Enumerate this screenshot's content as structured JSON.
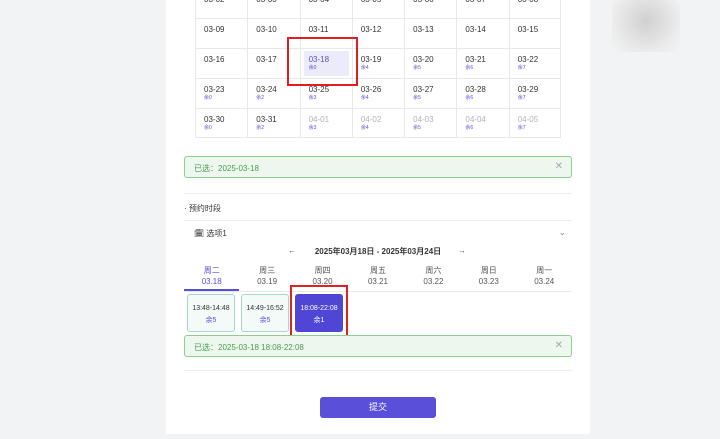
{
  "calendar": {
    "rows": [
      [
        {
          "d": "03-02",
          "r": ""
        },
        {
          "d": "03-03",
          "r": ""
        },
        {
          "d": "03-04",
          "r": ""
        },
        {
          "d": "03-05",
          "r": ""
        },
        {
          "d": "03-06",
          "r": ""
        },
        {
          "d": "03-07",
          "r": ""
        },
        {
          "d": "03-08",
          "r": ""
        }
      ],
      [
        {
          "d": "03-09",
          "r": ""
        },
        {
          "d": "03-10",
          "r": ""
        },
        {
          "d": "03-11",
          "r": ""
        },
        {
          "d": "03-12",
          "r": ""
        },
        {
          "d": "03-13",
          "r": ""
        },
        {
          "d": "03-14",
          "r": ""
        },
        {
          "d": "03-15",
          "r": ""
        }
      ],
      [
        {
          "d": "03-16",
          "r": ""
        },
        {
          "d": "03-17",
          "r": ""
        },
        {
          "d": "03-18",
          "r": "余0",
          "selected": true
        },
        {
          "d": "03-19",
          "r": "余4"
        },
        {
          "d": "03-20",
          "r": "余5"
        },
        {
          "d": "03-21",
          "r": "余6"
        },
        {
          "d": "03-22",
          "r": "余7"
        }
      ],
      [
        {
          "d": "03-23",
          "r": "余0"
        },
        {
          "d": "03-24",
          "r": "余2"
        },
        {
          "d": "03-25",
          "r": "余3"
        },
        {
          "d": "03-26",
          "r": "余4"
        },
        {
          "d": "03-27",
          "r": "余5"
        },
        {
          "d": "03-28",
          "r": "余6"
        },
        {
          "d": "03-29",
          "r": "余7"
        }
      ],
      [
        {
          "d": "03-30",
          "r": "余0"
        },
        {
          "d": "03-31",
          "r": "余2"
        },
        {
          "d": "04-01",
          "r": "余3",
          "other": true
        },
        {
          "d": "04-02",
          "r": "余4",
          "other": true
        },
        {
          "d": "04-03",
          "r": "余5",
          "other": true
        },
        {
          "d": "04-04",
          "r": "余6",
          "other": true
        },
        {
          "d": "04-05",
          "r": "余7",
          "other": true
        }
      ]
    ]
  },
  "date_alert": {
    "text": "已选：2025-03-18",
    "close": "✕"
  },
  "section": {
    "title": "· 预约时段"
  },
  "option": {
    "icon": "calendar-icon",
    "label": "选项1",
    "chevron": "⌄"
  },
  "week_nav": {
    "prev": "←",
    "range": "2025年03月18日 - 2025年03月24日",
    "next": "→"
  },
  "tabs": [
    {
      "day": "周二",
      "date": "03.18",
      "active": true
    },
    {
      "day": "周三",
      "date": "03.19"
    },
    {
      "day": "周四",
      "date": "03.20"
    },
    {
      "day": "周五",
      "date": "03.21"
    },
    {
      "day": "周六",
      "date": "03.22"
    },
    {
      "day": "周日",
      "date": "03.23"
    },
    {
      "day": "周一",
      "date": "03.24"
    }
  ],
  "slots": [
    {
      "time": "13:48-14:48",
      "rem": "余5"
    },
    {
      "time": "14:49-16:52",
      "rem": "余5"
    },
    {
      "time": "18:08-22:08",
      "rem": "余1",
      "active": true
    }
  ],
  "time_alert": {
    "text": "已选：2025-03-18 18:08-22:08",
    "close": "✕"
  },
  "submit_label": "提交",
  "colors": {
    "accent": "#5a4fd8",
    "highlight": "#e02020",
    "success_bg": "#edf7ee",
    "success_text": "#4a9a55"
  }
}
